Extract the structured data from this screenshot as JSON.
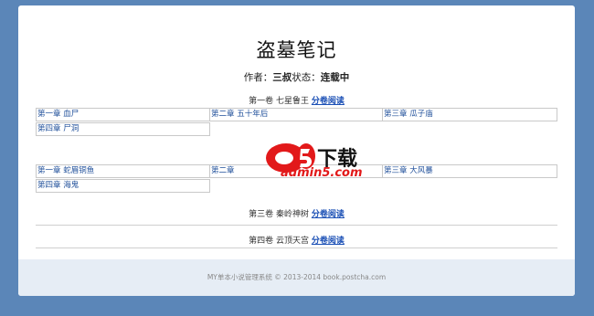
{
  "book": {
    "title": "盗墓笔记",
    "author_label": "作者：",
    "author": "三叔",
    "status_label": "状态：",
    "status": "连载中"
  },
  "volumes": [
    {
      "title": "第一卷 七星鲁王",
      "link": "分卷阅读",
      "chapters": [
        "第一章 血尸",
        "第二章 五十年后",
        "第三章 瓜子庙",
        "第四章 尸洞"
      ]
    },
    {
      "title": "",
      "link": "",
      "chapters": [
        "第一章 蛇眉铜鱼",
        "第二章",
        "第三章 大风暴",
        "第四章 海鬼"
      ]
    },
    {
      "title": "第三卷 秦岭神树",
      "link": "分卷阅读"
    },
    {
      "title": "第四卷 云顶天宫",
      "link": "分卷阅读"
    }
  ],
  "watermark": {
    "brand": "下载",
    "domain": "admin5.com"
  },
  "footer": "MY单本小说管理系统 © 2013-2014 book.postcha.com",
  "colors": {
    "background": "#5b86b8",
    "link": "#1a4fb5",
    "footer_bg": "#e6edf5"
  }
}
